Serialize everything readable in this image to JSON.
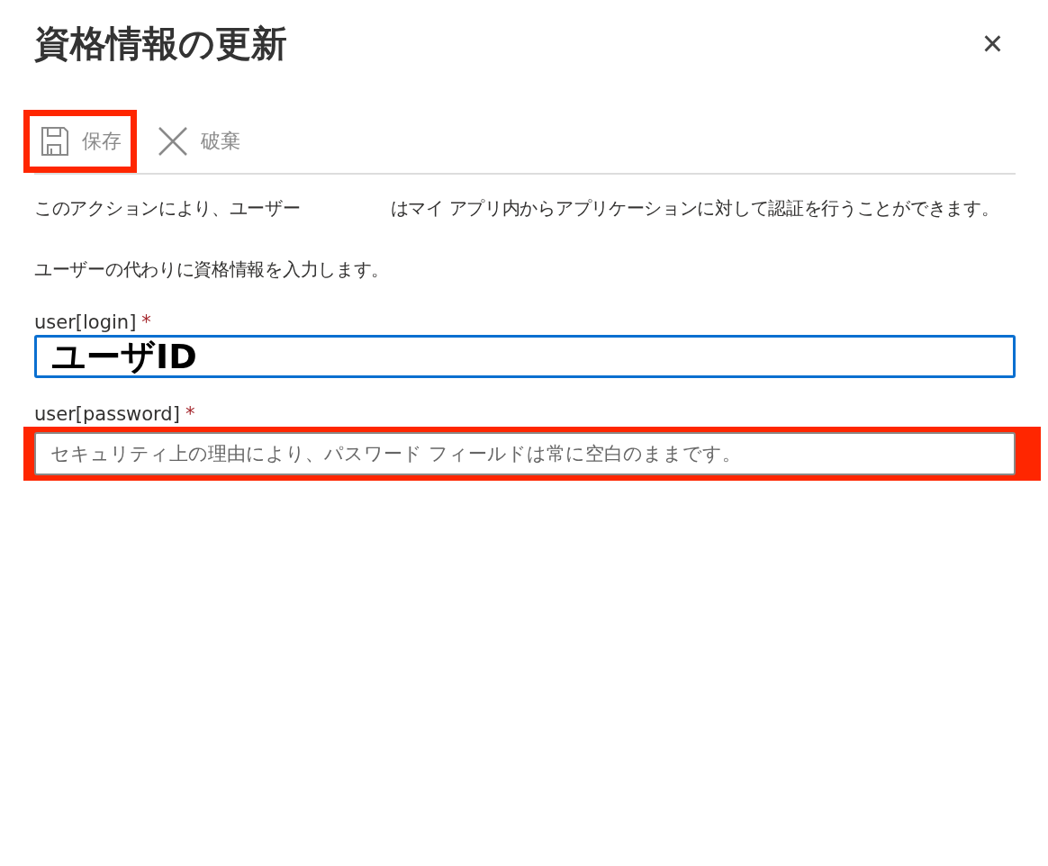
{
  "dialog": {
    "title": "資格情報の更新",
    "close_label": "×"
  },
  "toolbar": [
    {
      "kind": "save",
      "label": "保存",
      "disabled": true,
      "highlighted": true
    },
    {
      "kind": "discard",
      "label": "破棄",
      "disabled": true,
      "highlighted": false
    }
  ],
  "description": {
    "before": "このアクションにより、ユーザー",
    "after": "はマイ アプリ内からアプリケーションに対して認証を行うことができます。"
  },
  "instruction": "ユーザーの代わりに資格情報を入力します。",
  "fields": [
    {
      "label": "user[login]",
      "required_mark": "*",
      "value": "ユーザID",
      "focused": true,
      "highlighted": false
    },
    {
      "label": "user[password]",
      "required_mark": "*",
      "placeholder": "セキュリティ上の理由により、パスワード フィールドは常に空白のままです。",
      "focused": false,
      "highlighted": true
    }
  ]
}
